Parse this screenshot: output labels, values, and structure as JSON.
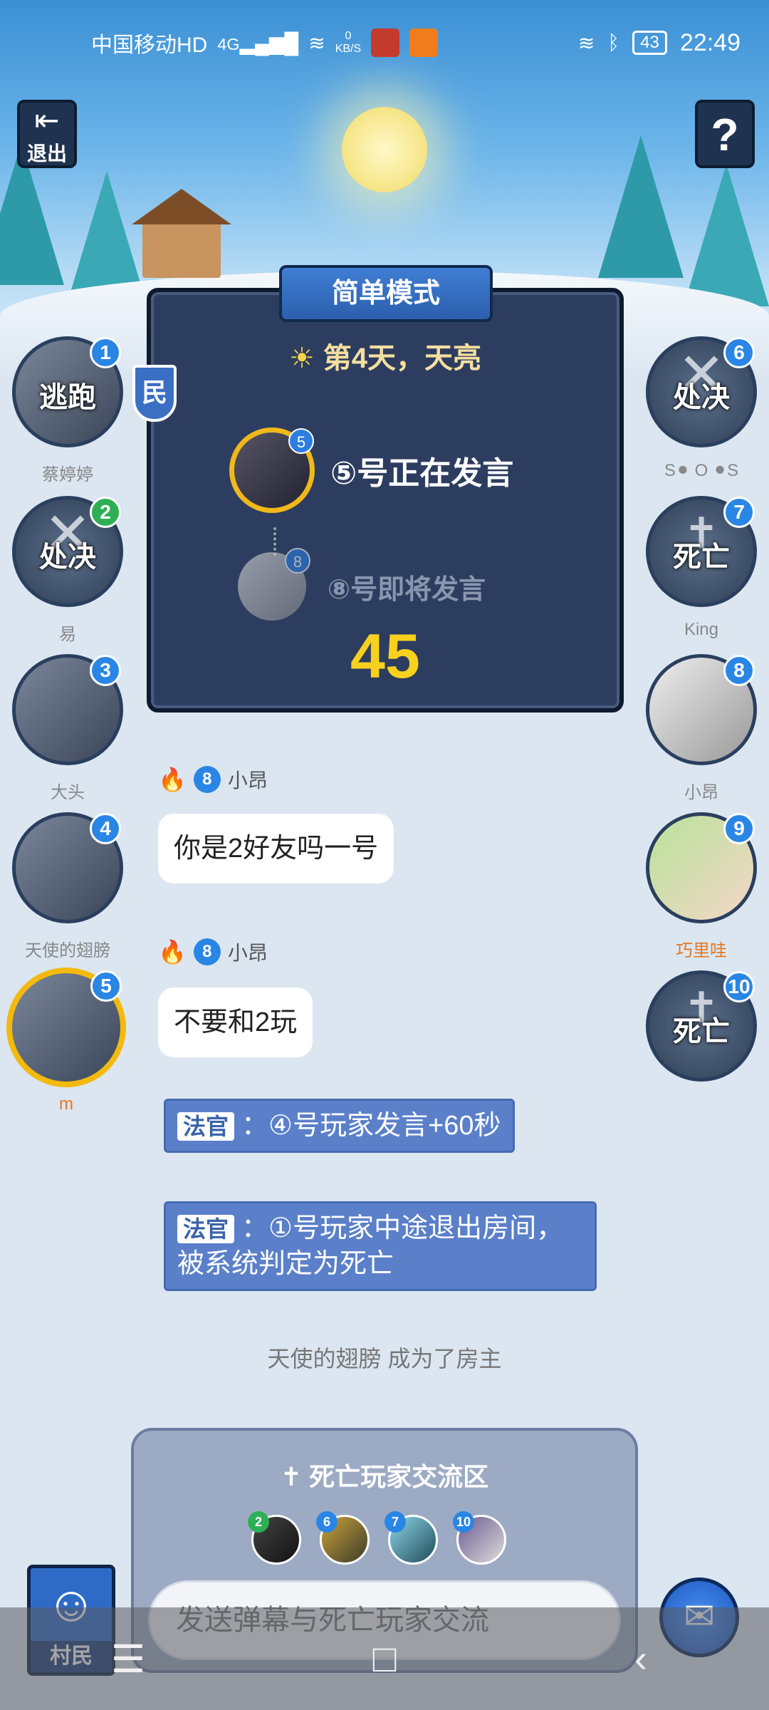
{
  "status_bar": {
    "carrier": "中国移动HD",
    "network": "4G",
    "speed_value": "0",
    "speed_unit": "KB/S",
    "battery": "43",
    "time": "22:49"
  },
  "top_buttons": {
    "exit_label": "退出",
    "help_glyph": "?"
  },
  "game": {
    "mode": "简单模式",
    "day_text": "第4天，天亮",
    "speaking_num": "5",
    "speaking_text": "⑤号正在发言",
    "next_num": "8",
    "next_text": "⑧号即将发言",
    "timer": "45"
  },
  "role_badge": "民",
  "players_left": [
    {
      "num": "1",
      "status": "逃跑",
      "name": "蔡婷婷"
    },
    {
      "num": "2",
      "status": "处决",
      "name": "易"
    },
    {
      "num": "3",
      "status": "",
      "name": "大头"
    },
    {
      "num": "4",
      "status": "",
      "name": "天使的翅膀"
    },
    {
      "num": "5",
      "status": "",
      "name": "m"
    }
  ],
  "players_right": [
    {
      "num": "6",
      "status": "处决",
      "name": "S⚫ O ⚫S"
    },
    {
      "num": "7",
      "status": "死亡",
      "name": "King"
    },
    {
      "num": "8",
      "status": "",
      "name": "小昂"
    },
    {
      "num": "9",
      "status": "",
      "name": "巧里哇"
    },
    {
      "num": "10",
      "status": "死亡",
      "name": ""
    }
  ],
  "chat": [
    {
      "num": "8",
      "name": "小昂",
      "text": "你是2好友吗一号"
    },
    {
      "num": "8",
      "name": "小昂",
      "text": "不要和2玩"
    }
  ],
  "judge_messages": [
    {
      "tag": "法官",
      "text": "：④号玩家发言+60秒"
    },
    {
      "tag": "法官",
      "text": "：①号玩家中途退出房间，被系统判定为死亡"
    }
  ],
  "system_message": "天使的翅膀 成为了房主",
  "dead_area": {
    "title": "死亡玩家交流区",
    "avatars": [
      "2",
      "6",
      "7",
      "10"
    ],
    "input_placeholder": "发送弹幕与死亡玩家交流"
  },
  "role_card": {
    "name": "村民"
  }
}
